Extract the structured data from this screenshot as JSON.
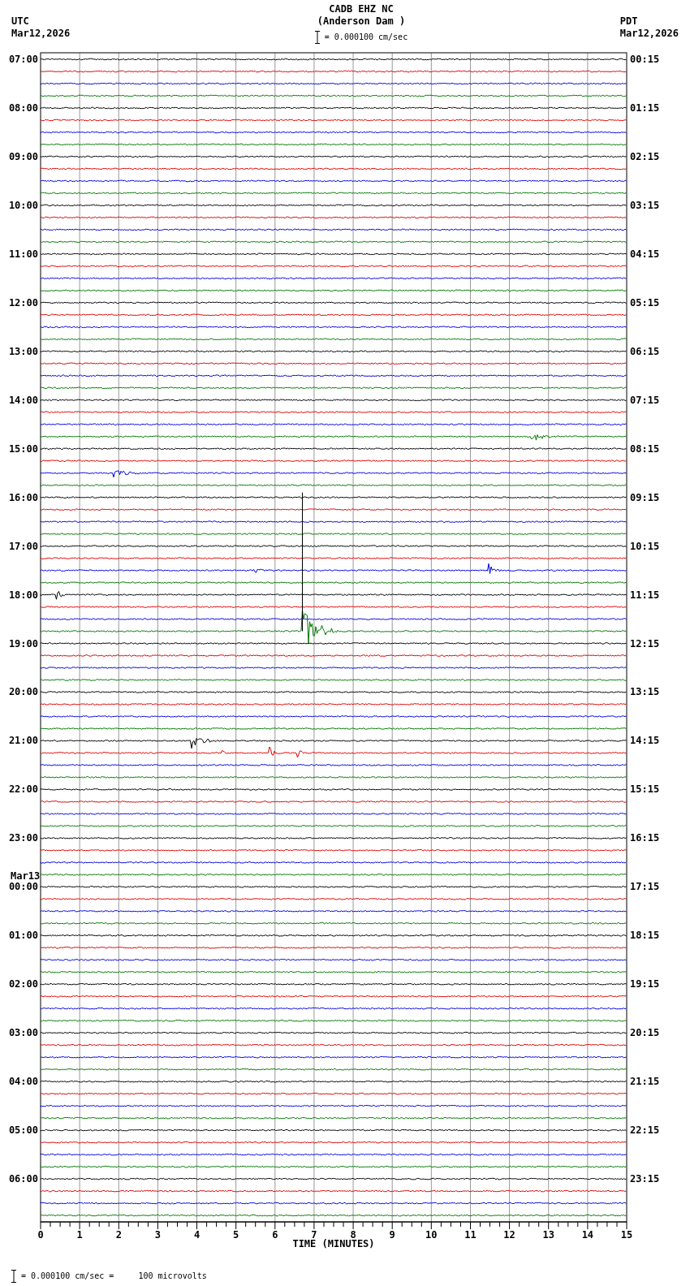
{
  "station": "CADB EHZ NC",
  "site": "(Anderson Dam )",
  "scale_label": "= 0.000100 cm/sec",
  "left": {
    "zone": "UTC",
    "date": "Mar12,2026"
  },
  "right": {
    "zone": "PDT",
    "date": "Mar12,2026"
  },
  "rows": [
    {
      "utc": "07:00",
      "pdt": "00:15"
    },
    {
      "utc": "08:00",
      "pdt": "01:15"
    },
    {
      "utc": "09:00",
      "pdt": "02:15"
    },
    {
      "utc": "10:00",
      "pdt": "03:15"
    },
    {
      "utc": "11:00",
      "pdt": "04:15"
    },
    {
      "utc": "12:00",
      "pdt": "05:15"
    },
    {
      "utc": "13:00",
      "pdt": "06:15"
    },
    {
      "utc": "14:00",
      "pdt": "07:15"
    },
    {
      "utc": "15:00",
      "pdt": "08:15"
    },
    {
      "utc": "16:00",
      "pdt": "09:15"
    },
    {
      "utc": "17:00",
      "pdt": "10:15"
    },
    {
      "utc": "18:00",
      "pdt": "11:15"
    },
    {
      "utc": "19:00",
      "pdt": "12:15"
    },
    {
      "utc": "20:00",
      "pdt": "13:15"
    },
    {
      "utc": "21:00",
      "pdt": "14:15"
    },
    {
      "utc": "22:00",
      "pdt": "15:15"
    },
    {
      "utc": "23:00",
      "pdt": "16:15"
    },
    {
      "utc": "00:00",
      "pdt": "17:15",
      "date": "Mar13"
    },
    {
      "utc": "01:00",
      "pdt": "18:15"
    },
    {
      "utc": "02:00",
      "pdt": "19:15"
    },
    {
      "utc": "03:00",
      "pdt": "20:15"
    },
    {
      "utc": "04:00",
      "pdt": "21:15"
    },
    {
      "utc": "05:00",
      "pdt": "22:15"
    },
    {
      "utc": "06:00",
      "pdt": "23:15"
    }
  ],
  "trace_colors": [
    {
      "color": "#000000"
    },
    {
      "color": "#e00000"
    },
    {
      "color": "#0000e0"
    },
    {
      "color": "#007800"
    }
  ],
  "x_ticks": [
    "0",
    "1",
    "2",
    "3",
    "4",
    "5",
    "6",
    "7",
    "8",
    "9",
    "10",
    "11",
    "12",
    "13",
    "14",
    "15"
  ],
  "x_title": "TIME (MINUTES)",
  "footer": "= 0.000100 cm/sec =     100 microvolts"
}
